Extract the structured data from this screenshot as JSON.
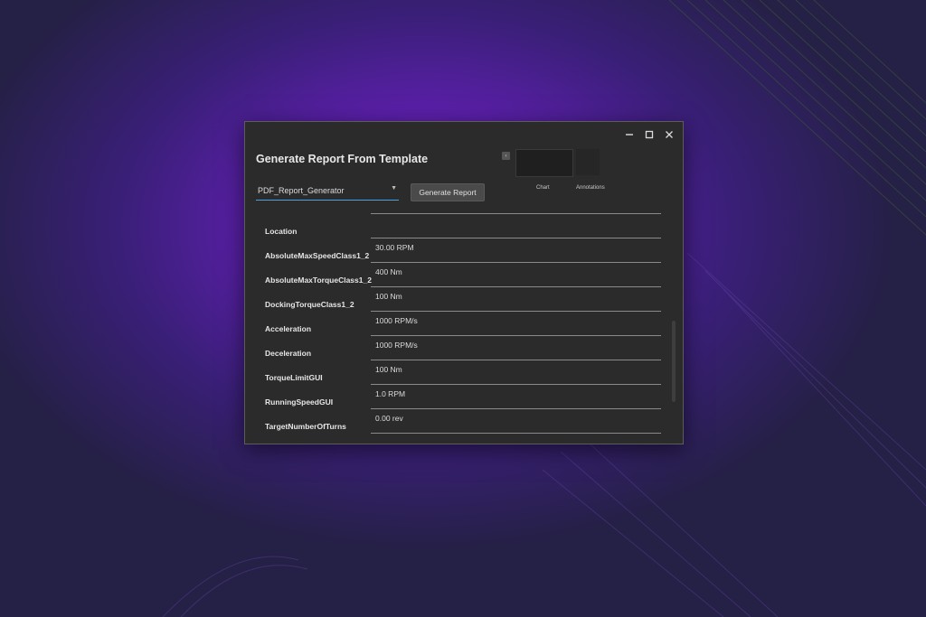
{
  "window": {
    "title": "Generate Report From Template",
    "controls": [
      "minimize-icon",
      "maximize-icon",
      "close-icon"
    ]
  },
  "toolbar": {
    "template_value": "PDF_Report_Generator",
    "generate_label": "Generate Report"
  },
  "thumbnails": {
    "chart_label": "Chart",
    "annotations_label": "Annotations"
  },
  "properties": [
    {
      "label": "Location",
      "value": ""
    },
    {
      "label": "AbsoluteMaxSpeedClass1_2",
      "value": "30.00 RPM"
    },
    {
      "label": "AbsoluteMaxTorqueClass1_2",
      "value": "400 Nm"
    },
    {
      "label": "DockingTorqueClass1_2",
      "value": "100 Nm"
    },
    {
      "label": "Acceleration",
      "value": "1000 RPM/s"
    },
    {
      "label": "Deceleration",
      "value": "1000 RPM/s"
    },
    {
      "label": "TorqueLimitGUI",
      "value": "100 Nm"
    },
    {
      "label": "RunningSpeedGUI",
      "value": "1.0 RPM"
    },
    {
      "label": "TargetNumberOfTurns",
      "value": "0.00 rev"
    }
  ],
  "colors": {
    "accent": "#4aa3e0",
    "window_bg": "#2b2b2b"
  }
}
